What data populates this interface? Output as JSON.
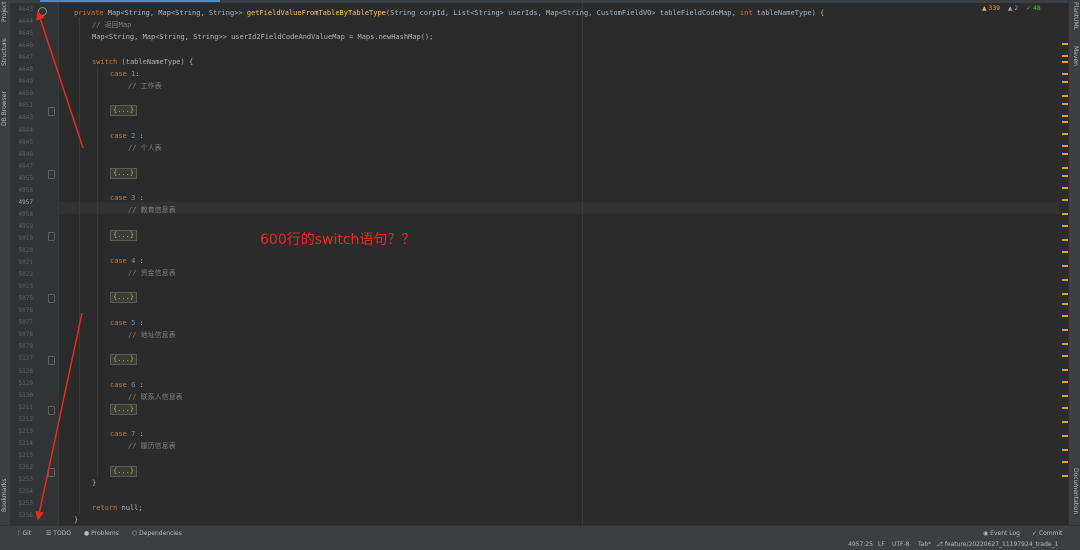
{
  "editor": {
    "signature": {
      "modifier": "private",
      "return_type": "Map<String, Map<String, String>>",
      "method": "getFieldValueFromTableByTableType",
      "params": "(String corpId, List<String> userIds, Map<String, CustomFieldVO> tableFieldCodeMap, ",
      "int_kw": "int",
      "params_end": " tableNameType) {"
    },
    "comment_return": "// 返回Map",
    "decl": "Map<String, Map<String, String>> userId2FieldCodeAndValueMap = Maps.newHashMap();",
    "switch_kw": "switch",
    "switch_rest": " (tableNameType) {",
    "case_kw": "case",
    "folded": "{...}",
    "cases": [
      {
        "num": "1",
        "sep": ":",
        "comment": "// 工作表"
      },
      {
        "num": "2",
        "sep": " :",
        "comment": "// 个人表"
      },
      {
        "num": "3",
        "sep": " :",
        "comment": "// 教育信息表"
      },
      {
        "num": "4",
        "sep": " :",
        "comment": "// 资金信息表"
      },
      {
        "num": "5",
        "sep": " :",
        "comment": "// 地址信息表"
      },
      {
        "num": "6",
        "sep": " :",
        "comment": "// 联系人信息表"
      },
      {
        "num": "7",
        "sep": " :",
        "comment": "// 履历信息表"
      }
    ],
    "close_brace": "}",
    "return_kw": "return",
    "return_rest": " null;",
    "method_close": "}"
  },
  "line_numbers": [
    "4643",
    "4644",
    "4645",
    "4646",
    "4647",
    "4648",
    "4649",
    "4650",
    "4651",
    "4843",
    "4844",
    "4845",
    "4846",
    "4847",
    "4955",
    "4956",
    "4957",
    "4958",
    "4959",
    "5019",
    "5020",
    "5021",
    "5022",
    "5023",
    "5075",
    "5076",
    "5077",
    "5078",
    "5079",
    "5127",
    "5128",
    "5129",
    "5130",
    "5211",
    "5212",
    "5213",
    "5214",
    "5215",
    "5252",
    "5253",
    "5254",
    "5255",
    "5256"
  ],
  "current_line": "4957",
  "inspections": {
    "warnings": "▲ 339",
    "weak": "▲ 2",
    "ok": "✓ 48"
  },
  "annotation": "600行的switch语句？？",
  "left_tools": [
    "Project",
    "Structure",
    "DB Browser",
    "Bookmarks"
  ],
  "right_tools": [
    "PlantUML",
    "Maven",
    "Documentation"
  ],
  "status": {
    "git": "Git",
    "todo": "TODO",
    "problems": "Problems",
    "dependencies": "Dependencies",
    "event_log": "Event Log",
    "commit": "Commit",
    "position": "4957:25",
    "line_sep": "LF",
    "encoding": "UTF-8",
    "indent": "Tab*",
    "branch": "feature/20220627_11197924_trade_1"
  },
  "colors": {
    "annotation": "#e52b21",
    "keyword": "#cc7832",
    "number": "#6897bb",
    "method": "#ffc66d",
    "comment": "#808080"
  }
}
